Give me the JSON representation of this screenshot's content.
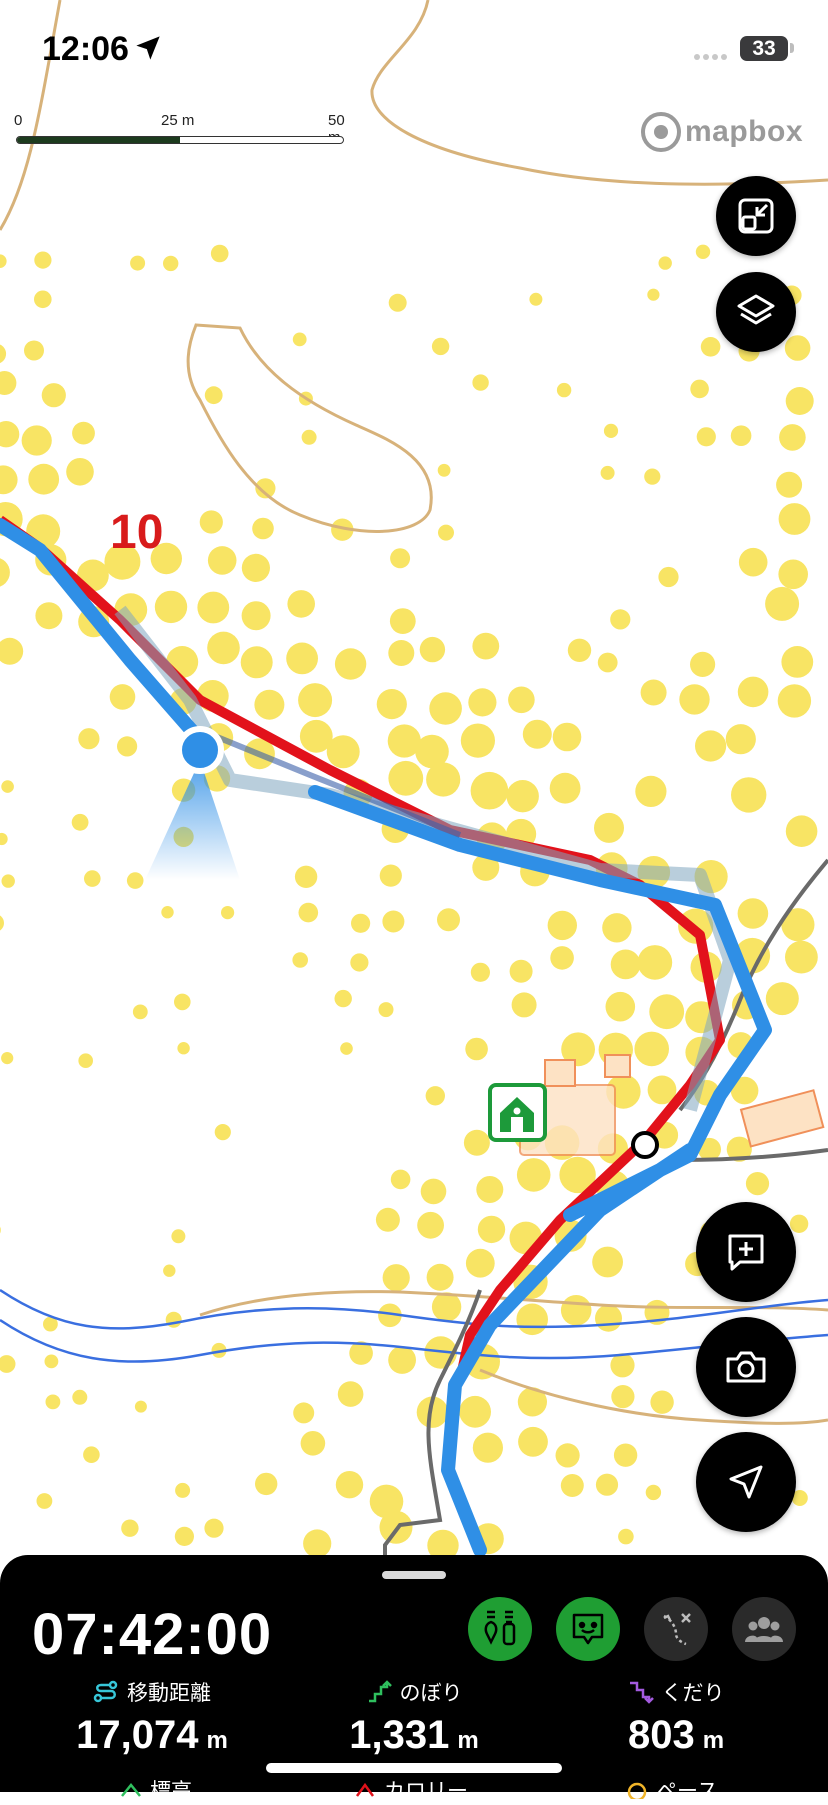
{
  "status_bar": {
    "time": "12:06",
    "battery": "33"
  },
  "scale_bar": {
    "ticks": [
      "0",
      "25 m",
      "50 m"
    ]
  },
  "attribution": {
    "logo_text": "mapbox"
  },
  "map": {
    "km_marker": "10"
  },
  "controls": {
    "collapse_icon": "collapse-icon",
    "layers_icon": "layers-icon",
    "add_note_icon": "add-note-icon",
    "camera_icon": "camera-icon",
    "navigate_icon": "navigate-icon"
  },
  "bottom_sheet": {
    "elapsed_time": "07:42:00",
    "modes": [
      {
        "icon": "bottle-icon",
        "active": true
      },
      {
        "icon": "chat-icon",
        "active": true
      },
      {
        "icon": "route-branch-icon",
        "active": false
      },
      {
        "icon": "group-icon",
        "active": false
      }
    ],
    "stats": [
      {
        "label": "移動距離",
        "value": "17,074",
        "unit": "m",
        "icon": "distance-icon",
        "color": "#37c6d8"
      },
      {
        "label": "のぼり",
        "value": "1,331",
        "unit": "m",
        "icon": "ascent-icon",
        "color": "#2fbf5e"
      },
      {
        "label": "くだり",
        "value": "803",
        "unit": "m",
        "icon": "descent-icon",
        "color": "#a45be0"
      }
    ],
    "partial_row": [
      "標高",
      "カロリー",
      "ペース"
    ]
  },
  "colors": {
    "track_planned": "#e2121b",
    "track_actual": "#2f8fe6",
    "contour": "#d7b27a",
    "river": "#3a6fe0",
    "heat_dot": "#f7e04a",
    "active_mode": "#1f9e33"
  }
}
